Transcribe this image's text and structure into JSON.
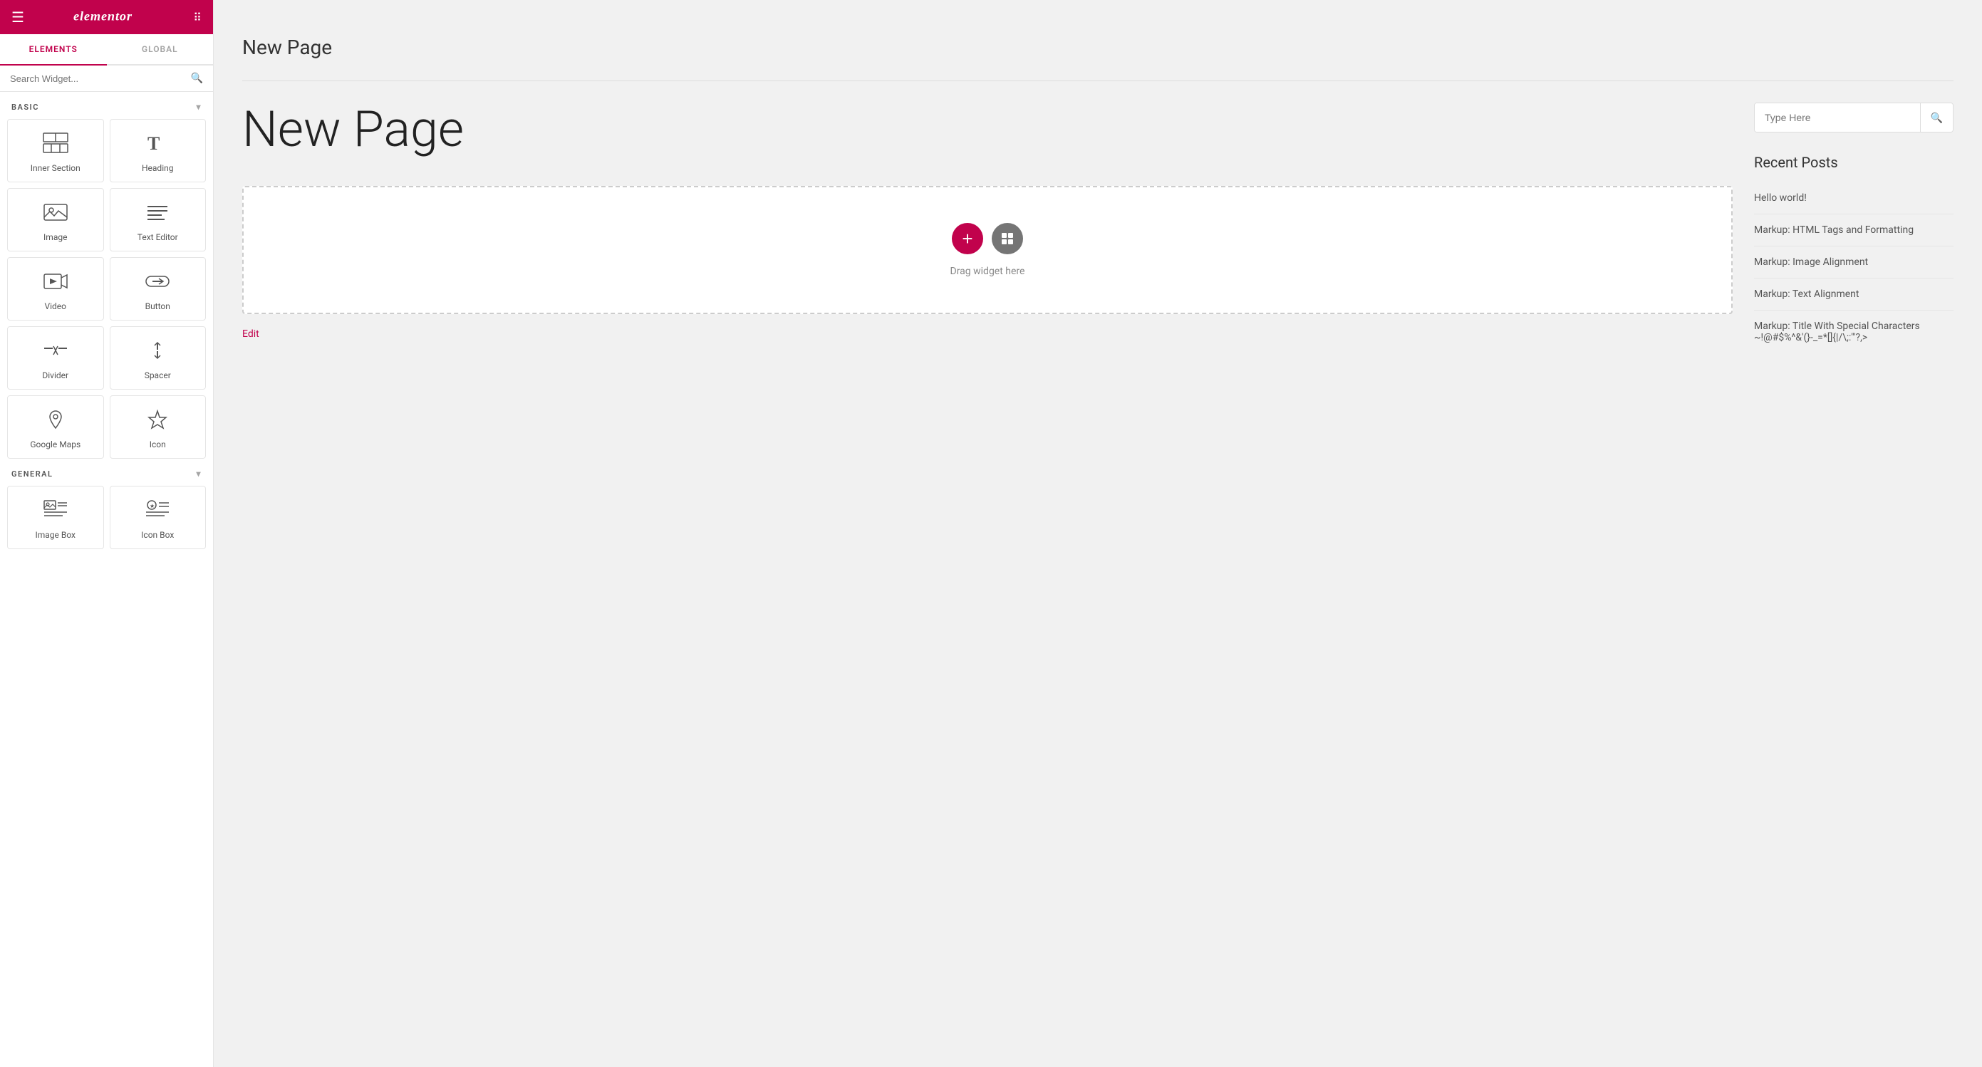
{
  "topbar": {
    "logo": "elementor",
    "hamburger_unicode": "☰",
    "grid_unicode": "⋮⋮⋮"
  },
  "tabs": [
    {
      "id": "elements",
      "label": "Elements",
      "active": true
    },
    {
      "id": "global",
      "label": "Global",
      "active": false
    }
  ],
  "search": {
    "placeholder": "Search Widget..."
  },
  "sections": [
    {
      "id": "basic",
      "label": "Basic",
      "expanded": true,
      "widgets": [
        {
          "id": "inner-section",
          "label": "Inner Section",
          "icon": "inner-section-icon"
        },
        {
          "id": "heading",
          "label": "Heading",
          "icon": "heading-icon"
        },
        {
          "id": "image",
          "label": "Image",
          "icon": "image-icon"
        },
        {
          "id": "text-editor",
          "label": "Text Editor",
          "icon": "text-editor-icon"
        },
        {
          "id": "video",
          "label": "Video",
          "icon": "video-icon"
        },
        {
          "id": "button",
          "label": "Button",
          "icon": "button-icon"
        },
        {
          "id": "divider",
          "label": "Divider",
          "icon": "divider-icon"
        },
        {
          "id": "spacer",
          "label": "Spacer",
          "icon": "spacer-icon"
        },
        {
          "id": "google-maps",
          "label": "Google Maps",
          "icon": "google-maps-icon"
        },
        {
          "id": "icon",
          "label": "Icon",
          "icon": "icon-icon"
        }
      ]
    },
    {
      "id": "general",
      "label": "General",
      "expanded": true,
      "widgets": [
        {
          "id": "image-box",
          "label": "Image Box",
          "icon": "image-box-icon"
        },
        {
          "id": "icon-box",
          "label": "Icon Box",
          "icon": "icon-box-icon"
        }
      ]
    }
  ],
  "canvas": {
    "page_title_top": "New Page",
    "page_title_big": "New Page",
    "drag_hint": "Drag widget here",
    "edit_link": "Edit"
  },
  "right_sidebar": {
    "search_placeholder": "Type Here",
    "recent_posts_title": "Recent Posts",
    "posts": [
      "Hello world!",
      "Markup: HTML Tags and Formatting",
      "Markup: Image Alignment",
      "Markup: Text Alignment",
      "Markup: Title With Special Characters ~!@#$%^&'(}-_=*[]{|/\\;:'\"?,>"
    ]
  },
  "collapse": {
    "icon": "❮"
  }
}
